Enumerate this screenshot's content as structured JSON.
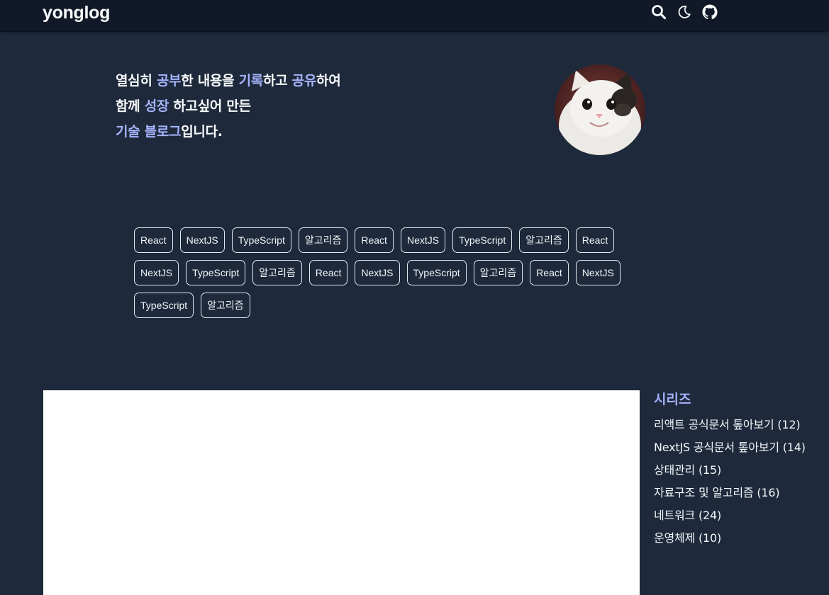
{
  "header": {
    "logo": "yonglog",
    "icons": [
      "search-icon",
      "moon-icon",
      "github-icon"
    ]
  },
  "intro": {
    "line1": [
      {
        "text": "열심히 ",
        "hl": false
      },
      {
        "text": "공부",
        "hl": true
      },
      {
        "text": "한 내용을 ",
        "hl": false
      },
      {
        "text": "기록",
        "hl": true
      },
      {
        "text": "하고 ",
        "hl": false
      },
      {
        "text": "공유",
        "hl": true
      },
      {
        "text": "하여",
        "hl": false
      }
    ],
    "line2": [
      {
        "text": "함께 ",
        "hl": false
      },
      {
        "text": "성장",
        "hl": true
      },
      {
        "text": " 하고싶어 만든",
        "hl": false
      }
    ],
    "line3": [
      {
        "text": "기술 블로그",
        "hl": true
      },
      {
        "text": "입니다.",
        "hl": false
      }
    ]
  },
  "tags": [
    "React",
    "NextJS",
    "TypeScript",
    "알고리즘",
    "React",
    "NextJS",
    "TypeScript",
    "알고리즘",
    "React",
    "NextJS",
    "TypeScript",
    "알고리즘",
    "React",
    "NextJS",
    "TypeScript",
    "알고리즘",
    "React",
    "NextJS",
    "TypeScript",
    "알고리즘"
  ],
  "series": {
    "title": "시리즈",
    "items": [
      "리액트 공식문서 톺아보기 (12)",
      "NextJS 공식문서 톺아보기 (14)",
      "상태관리 (15)",
      "자료구조 및 알고리즘 (16)",
      "네트워크 (24)",
      "운영체제 (10)"
    ]
  },
  "colors": {
    "background": "#1e293b",
    "header": "#111827",
    "accent": "#a5b4fc",
    "text": "#f1f5f9",
    "content_panel": "#ffffff"
  }
}
